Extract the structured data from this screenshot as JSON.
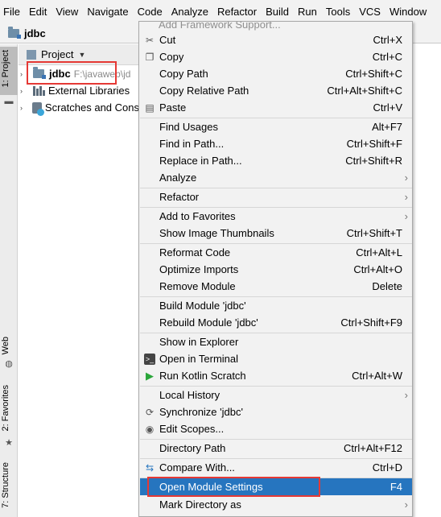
{
  "menubar": [
    "File",
    "Edit",
    "View",
    "Navigate",
    "Code",
    "Analyze",
    "Refactor",
    "Build",
    "Run",
    "Tools",
    "VCS",
    "Window"
  ],
  "navbar": {
    "title": "jdbc"
  },
  "stripe": {
    "project": "1: Project",
    "web": "Web",
    "favorites": "2: Favorites",
    "structure": "7: Structure"
  },
  "panel": {
    "header": "Project",
    "tree": [
      {
        "label": "jdbc",
        "hint": "F:\\javaweb\\jd"
      },
      {
        "label": "External Libraries"
      },
      {
        "label": "Scratches and Cons"
      }
    ]
  },
  "menu": {
    "cut_off_top": "Add Framework Support...",
    "items": [
      {
        "label": "Cut",
        "shortcut": "Ctrl+X"
      },
      {
        "label": "Copy",
        "shortcut": "Ctrl+C"
      },
      {
        "label": "Copy Path",
        "shortcut": "Ctrl+Shift+C"
      },
      {
        "label": "Copy Relative Path",
        "shortcut": "Ctrl+Alt+Shift+C"
      },
      {
        "label": "Paste",
        "shortcut": "Ctrl+V"
      },
      {
        "label": "Find Usages",
        "shortcut": "Alt+F7"
      },
      {
        "label": "Find in Path...",
        "shortcut": "Ctrl+Shift+F"
      },
      {
        "label": "Replace in Path...",
        "shortcut": "Ctrl+Shift+R"
      },
      {
        "label": "Analyze",
        "shortcut": ""
      },
      {
        "label": "Refactor",
        "shortcut": ""
      },
      {
        "label": "Add to Favorites",
        "shortcut": ""
      },
      {
        "label": "Show Image Thumbnails",
        "shortcut": "Ctrl+Shift+T"
      },
      {
        "label": "Reformat Code",
        "shortcut": "Ctrl+Alt+L"
      },
      {
        "label": "Optimize Imports",
        "shortcut": "Ctrl+Alt+O"
      },
      {
        "label": "Remove Module",
        "shortcut": "Delete"
      },
      {
        "label": "Build Module 'jdbc'",
        "shortcut": ""
      },
      {
        "label": "Rebuild Module 'jdbc'",
        "shortcut": "Ctrl+Shift+F9"
      },
      {
        "label": "Show in Explorer",
        "shortcut": ""
      },
      {
        "label": "Open in Terminal",
        "shortcut": ""
      },
      {
        "label": "Run Kotlin Scratch",
        "shortcut": "Ctrl+Alt+W"
      },
      {
        "label": "Local History",
        "shortcut": ""
      },
      {
        "label": "Synchronize 'jdbc'",
        "shortcut": ""
      },
      {
        "label": "Edit Scopes...",
        "shortcut": ""
      },
      {
        "label": "Directory Path",
        "shortcut": "Ctrl+Alt+F12"
      },
      {
        "label": "Compare With...",
        "shortcut": "Ctrl+D"
      },
      {
        "label": "Open Module Settings",
        "shortcut": "F4"
      },
      {
        "label": "Mark Directory as",
        "shortcut": ""
      }
    ]
  },
  "colors": {
    "highlight": "#2675bf",
    "annotation": "#e53935",
    "run_green": "#2aa63a"
  }
}
